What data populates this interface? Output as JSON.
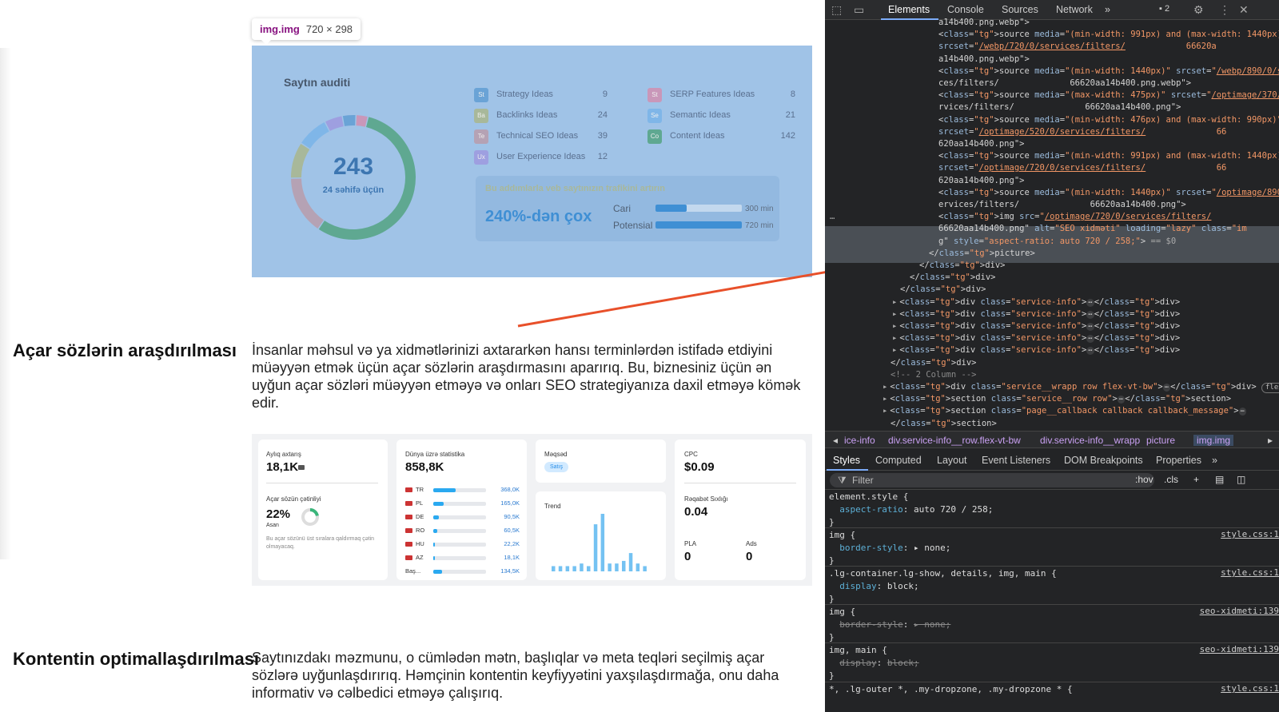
{
  "tooltip": {
    "tag": "img.img",
    "size": "720 × 298"
  },
  "audit": {
    "title": "Saytın auditi",
    "total": "243",
    "subtitle": "24 səhifə üçün",
    "ideas": [
      {
        "abbr": "St",
        "name": "Strategy Ideas",
        "count": "9",
        "color": "#6aa3d6"
      },
      {
        "abbr": "Ba",
        "name": "Backlinks Ideas",
        "count": "24",
        "color": "#a8b89a"
      },
      {
        "abbr": "Te",
        "name": "Technical SEO Ideas",
        "count": "39",
        "color": "#b5a2b4"
      },
      {
        "abbr": "Ux",
        "name": "User Experience Ideas",
        "count": "12",
        "color": "#9e9fe0"
      },
      {
        "abbr": "St",
        "name": "SERP Features Ideas",
        "count": "8",
        "color": "#c997b9"
      },
      {
        "abbr": "Se",
        "name": "Semantic Ideas",
        "count": "21",
        "color": "#7fb6e8"
      },
      {
        "abbr": "Co",
        "name": "Content Ideas",
        "count": "142",
        "color": "#5fa891"
      }
    ],
    "growth": {
      "title": "Bu addımlarla veb saytınızın trafikini artırın",
      "percent": "240%-dən çox",
      "rows": [
        {
          "label": "Cari",
          "value": "300 min",
          "fraction": 0.36
        },
        {
          "label": "Potensial",
          "value": "720 min",
          "fraction": 1.0
        }
      ]
    },
    "segments": [
      {
        "value": 142,
        "color": "#5fa891"
      },
      {
        "value": 39,
        "color": "#b5a2b4"
      },
      {
        "value": 24,
        "color": "#a8b89a"
      },
      {
        "value": 21,
        "color": "#7fb6e8"
      },
      {
        "value": 12,
        "color": "#9e9fe0"
      },
      {
        "value": 9,
        "color": "#6aa3d6"
      },
      {
        "value": 8,
        "color": "#c997b9"
      }
    ]
  },
  "section1": {
    "heading": "Açar sözlərin araşdırılması",
    "text": "İnsanlar məhsul və ya xidmətlərinizi axtararkən hansı terminlərdən istifadə etdiyini müəyyən etmək üçün açar sözlərin araşdırmasını aparırıq. Bu, biznesiniz üçün ən uyğun açar sözləri müəyyən etməyə və onları SEO strategiyanıza daxil etməyə kömək edir."
  },
  "keyword": {
    "monthly_label": "Aylıq axtarış",
    "monthly_value": "18,1K",
    "difficulty_label": "Açar sözün çətinliyi",
    "difficulty_value": "22%",
    "difficulty_fraction": 0.22,
    "difficulty_level": "Asan",
    "difficulty_note": "Bu açar sözünü üst sıralara qaldırmaq çətin olmayacaq.",
    "world_label": "Dünya üzrə statistika",
    "world_value": "858,8K",
    "countries": [
      {
        "code": "TR",
        "value": "368,0K",
        "fraction": 0.43
      },
      {
        "code": "PL",
        "value": "165,0K",
        "fraction": 0.19
      },
      {
        "code": "DE",
        "value": "90,5K",
        "fraction": 0.11
      },
      {
        "code": "RO",
        "value": "60,5K",
        "fraction": 0.07
      },
      {
        "code": "HU",
        "value": "22,2K",
        "fraction": 0.03
      },
      {
        "code": "AZ",
        "value": "18,1K",
        "fraction": 0.02
      },
      {
        "code": "Baş...",
        "value": "134,5K",
        "fraction": 0.16
      }
    ],
    "intent_label": "Məqsəd",
    "intent_value": "Satış",
    "trend_label": "Trend",
    "trend_values": [
      2,
      2,
      2,
      2,
      3,
      2,
      18,
      22,
      3,
      3,
      4,
      7,
      3,
      2
    ],
    "cpc_label": "CPC",
    "cpc_value": "$0.09",
    "competition_label": "Rəqabət Sıxlığı",
    "competition_value": "0.04",
    "pla_label": "PLA",
    "pla_value": "0",
    "ads_label": "Ads",
    "ads_value": "0"
  },
  "section2": {
    "heading": "Kontentin optimallaşdırılması",
    "text": "Saytınızdakı məzmunu, o cümlədən mətn, başlıqlar və meta teqləri seçilmiş açar sözlərə uyğunlaşdırırıq. Həmçinin kontentin keyfiyyətini yaxşılaşdırmağa, onu daha informativ və cəlbedici etməyə çalışırıq."
  },
  "devtools": {
    "tabs": [
      "Elements",
      "Console",
      "Sources",
      "Network"
    ],
    "more": "»",
    "issues": "2",
    "breadcrumbs": [
      "ice-info",
      "div.service-info__row.flex-vt-bw",
      "div.service-info__wrapp",
      "picture",
      "img.img"
    ],
    "subtabs": [
      "Styles",
      "Computed",
      "Layout",
      "Event Listeners",
      "DOM Breakpoints",
      "Properties"
    ],
    "filter_placeholder": "Filter",
    "hov": ":hov",
    "cls": ".cls",
    "code": [
      "a14b400.png.webp\">",
      "<source media=\"(min-width: 991px) and (max-width: 1440px)\"",
      "srcset=\"/webp/720/0/services/filters/            66620a",
      "a14b400.png.webp\">",
      "<source media=\"(min-width: 1440px)\" srcset=\"/webp/890/0/servi",
      "ces/filters/              66620aa14b400.png.webp\">",
      "<source media=\"(max-width: 475px)\" srcset=\"/optimage/370/0/se",
      "rvices/filters/              66620aa14b400.png\">",
      "<source media=\"(min-width: 476px) and (max-width: 990px)\"",
      "srcset=\"/optimage/520/0/services/filters/              66",
      "620aa14b400.png\">",
      "<source media=\"(min-width: 991px) and (max-width: 1440px)\"",
      "srcset=\"/optimage/720/0/services/filters/              66",
      "620aa14b400.png\">",
      "<source media=\"(min-width: 1440px)\" srcset=\"/optimage/890/0/s",
      "ervices/filters/              66620aa14b400.png\">",
      "<img src=\"/optimage/720/0/services/filters/",
      "66620aa14b400.png\" alt=\"SEO xidməti\" loading=\"lazy\" class=\"im",
      "g\" style=\"aspect-ratio: auto 720 / 258;\"> == $0",
      "</picture>",
      "</div>",
      "</div>",
      "</div>",
      "<div class=\"service-info\">…</div>",
      "<div class=\"service-info\">…</div>",
      "<div class=\"service-info\">…</div>",
      "<div class=\"service-info\">…</div>",
      "<div class=\"service-info\">…</div>",
      "</div>",
      "<!-- 2 Column -->",
      "<div class=\"service__wrapp row flex-vt-bw\">…</div>",
      "<section class=\"service__row row\">…</section>",
      "<section class=\"page__callback callback callback_message\">…",
      "</section>"
    ],
    "flex_badge": "flex",
    "styles": [
      {
        "selector": "element.style {",
        "props": [
          {
            "name": "aspect-ratio",
            "value": "auto 720 / 258;"
          }
        ],
        "source": ""
      },
      {
        "selector": "img {",
        "props": [
          {
            "name": "border-style",
            "value": "▸ none;"
          }
        ],
        "source": "style.css:1"
      },
      {
        "selector": ".lg-container.lg-show, details, img, main {",
        "props": [
          {
            "name": "display",
            "value": "block;"
          }
        ],
        "source": "style.css:1"
      },
      {
        "selector": "img {",
        "props": [
          {
            "name": "border-style",
            "value": "▸ none;",
            "struck": true
          }
        ],
        "source": "seo-xidmeti:139"
      },
      {
        "selector": "img, main {",
        "props": [
          {
            "name": "display",
            "value": "block;",
            "struck": true
          }
        ],
        "source": "seo-xidmeti:139"
      },
      {
        "selector": "*, .lg-outer *, .my-dropzone, .my-dropzone * {",
        "props": [],
        "source": "style.css:1"
      }
    ]
  }
}
